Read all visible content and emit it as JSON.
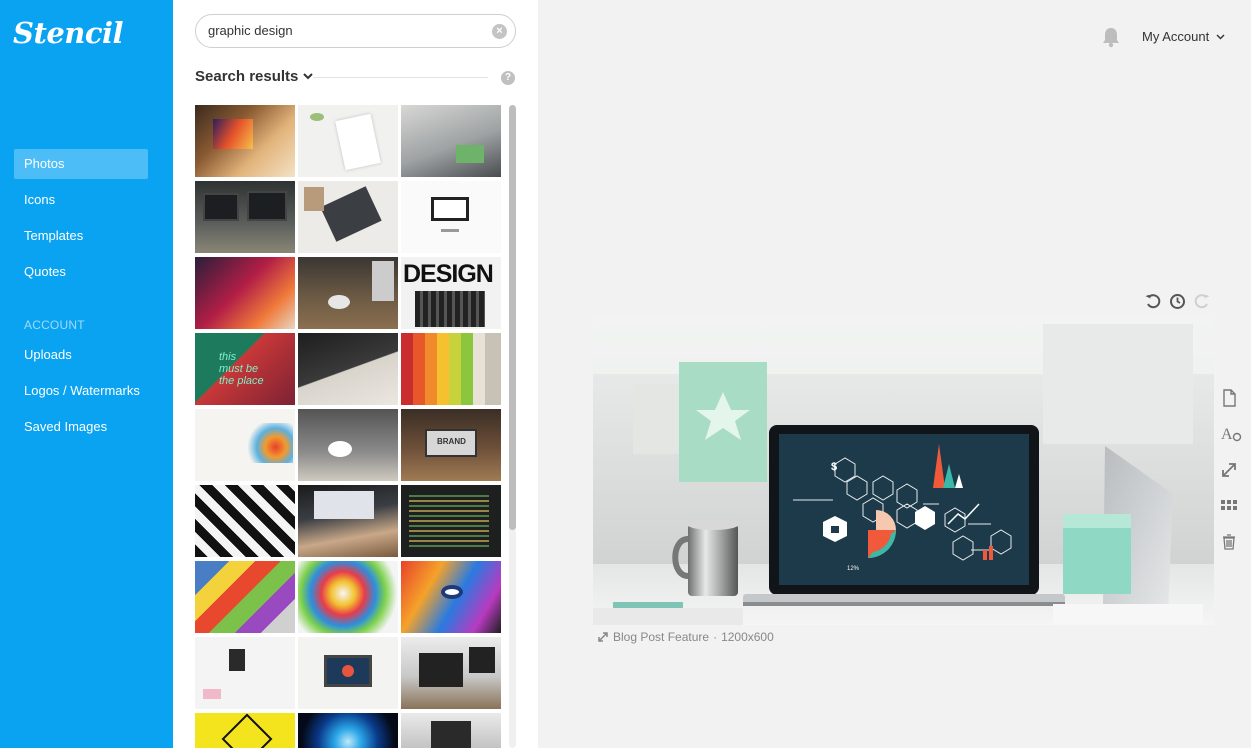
{
  "app": {
    "logo": "Stencil"
  },
  "sidebar": {
    "items": [
      {
        "label": "Photos",
        "active": true
      },
      {
        "label": "Icons"
      },
      {
        "label": "Templates"
      },
      {
        "label": "Quotes"
      }
    ],
    "account_section": "ACCOUNT",
    "account_items": [
      {
        "label": "Uploads"
      },
      {
        "label": "Logos / Watermarks"
      },
      {
        "label": "Saved Images"
      }
    ]
  },
  "search": {
    "value": "graphic design",
    "placeholder": ""
  },
  "results": {
    "heading": "Search results"
  },
  "header": {
    "account_label": "My Account"
  },
  "canvas": {
    "template": "Blog Post Feature",
    "size": "1200x600"
  },
  "colors": {
    "brand": "#0aa3f2",
    "active_nav": "#4cbdf6"
  }
}
